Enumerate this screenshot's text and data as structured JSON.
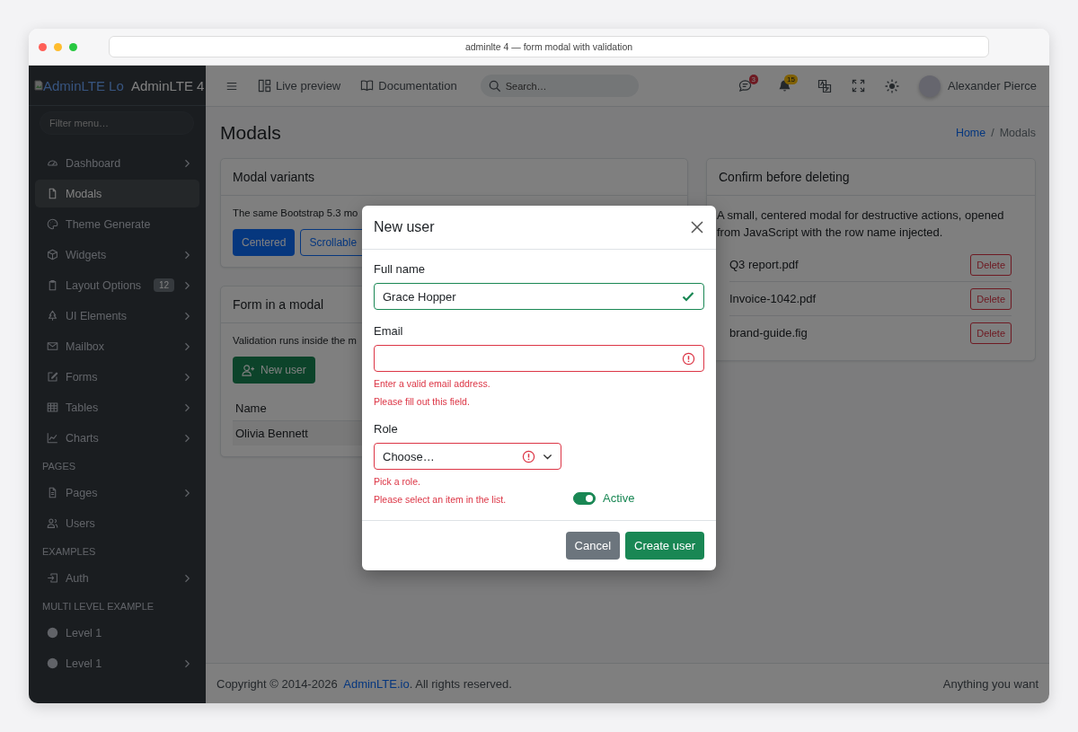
{
  "browser": {
    "address": "adminlte 4 — form modal with validation"
  },
  "sidebar": {
    "logo_alt": "AdminLTE Lo",
    "brand": "AdminLTE 4",
    "filter": {
      "placeholder": "Filter menu…"
    },
    "items": [
      {
        "kind": "link",
        "label": "Dashboard",
        "selected": false,
        "expandable": true
      },
      {
        "kind": "link",
        "label": "Modals",
        "selected": true,
        "expandable": false
      },
      {
        "kind": "link",
        "label": "Theme Generate",
        "selected": false,
        "expandable": false
      },
      {
        "kind": "link",
        "label": "Widgets",
        "selected": false,
        "expandable": true
      },
      {
        "kind": "link",
        "label": "Layout Options",
        "selected": false,
        "expandable": true,
        "badge": "12"
      },
      {
        "kind": "link",
        "label": "UI Elements",
        "selected": false,
        "expandable": true
      },
      {
        "kind": "link",
        "label": "Mailbox",
        "selected": false,
        "expandable": true
      },
      {
        "kind": "link",
        "label": "Forms",
        "selected": false,
        "expandable": true
      },
      {
        "kind": "link",
        "label": "Tables",
        "selected": false,
        "expandable": true
      },
      {
        "kind": "link",
        "label": "Charts",
        "selected": false,
        "expandable": true
      },
      {
        "kind": "header",
        "label": "PAGES"
      },
      {
        "kind": "link",
        "label": "Pages",
        "selected": false,
        "expandable": true
      },
      {
        "kind": "link",
        "label": "Users",
        "selected": false,
        "expandable": false
      },
      {
        "kind": "header",
        "label": "EXAMPLES"
      },
      {
        "kind": "link",
        "label": "Auth",
        "selected": false,
        "expandable": true
      },
      {
        "kind": "header",
        "label": "MULTI LEVEL EXAMPLE"
      },
      {
        "kind": "link",
        "label": "Level 1",
        "selected": false,
        "expandable": false
      },
      {
        "kind": "link",
        "label": "Level 1",
        "selected": false,
        "expandable": true
      }
    ]
  },
  "navbar": {
    "links": [
      "Live preview",
      "Documentation"
    ],
    "search": {
      "placeholder": "Search…"
    },
    "messages_badge": "3",
    "notifications_badge": "15",
    "user": "Alexander Pierce"
  },
  "page": {
    "title": "Modals",
    "breadcrumb": [
      {
        "label": "Home",
        "link": true
      },
      {
        "label": "Modals",
        "link": false
      }
    ],
    "breadcrumb_separator": "/"
  },
  "cards": {
    "variants": {
      "title": "Modal variants",
      "text": "The same Bootstrap 5.3 mo",
      "buttons": [
        {
          "label": "Centered",
          "kind": "solid"
        },
        {
          "label": "Scrollable",
          "kind": "outline"
        }
      ]
    },
    "form": {
      "title": "Form in a modal",
      "text": "Validation runs inside the m",
      "button": "New user",
      "table": {
        "columns": [
          "Name"
        ],
        "rows": [
          [
            "Olivia Bennett"
          ]
        ]
      }
    },
    "confirm": {
      "title": "Confirm before deleting",
      "text": "A small, centered modal for destructive actions, opened from JavaScript with the row name injected.",
      "files": [
        {
          "name": "Q3 report.pdf",
          "action": "Delete"
        },
        {
          "name": "Invoice-1042.pdf",
          "action": "Delete"
        },
        {
          "name": "brand-guide.fig",
          "action": "Delete"
        }
      ]
    }
  },
  "modal": {
    "title": "New user",
    "fields": [
      {
        "kind": "text",
        "label": "Full name",
        "value": "Grace Hopper",
        "valid": true
      },
      {
        "kind": "text",
        "label": "Email",
        "valid": false,
        "errors": [
          "Enter a valid email address.",
          "Please fill out this field."
        ]
      },
      {
        "kind": "select",
        "label": "Role",
        "value": "Choose…",
        "valid": false,
        "errors": [
          "Pick a role.",
          "Please select an item in the list."
        ]
      }
    ],
    "switch": {
      "label": "Active",
      "on": true
    },
    "buttons": [
      {
        "label": "Cancel",
        "kind": "secondary"
      },
      {
        "label": "Create user",
        "kind": "primary"
      }
    ]
  },
  "footer": {
    "copyright": "Copyright © 2014-2026",
    "link": "AdminLTE.io",
    "rest": ". All rights reserved.",
    "right": "Anything you want"
  }
}
